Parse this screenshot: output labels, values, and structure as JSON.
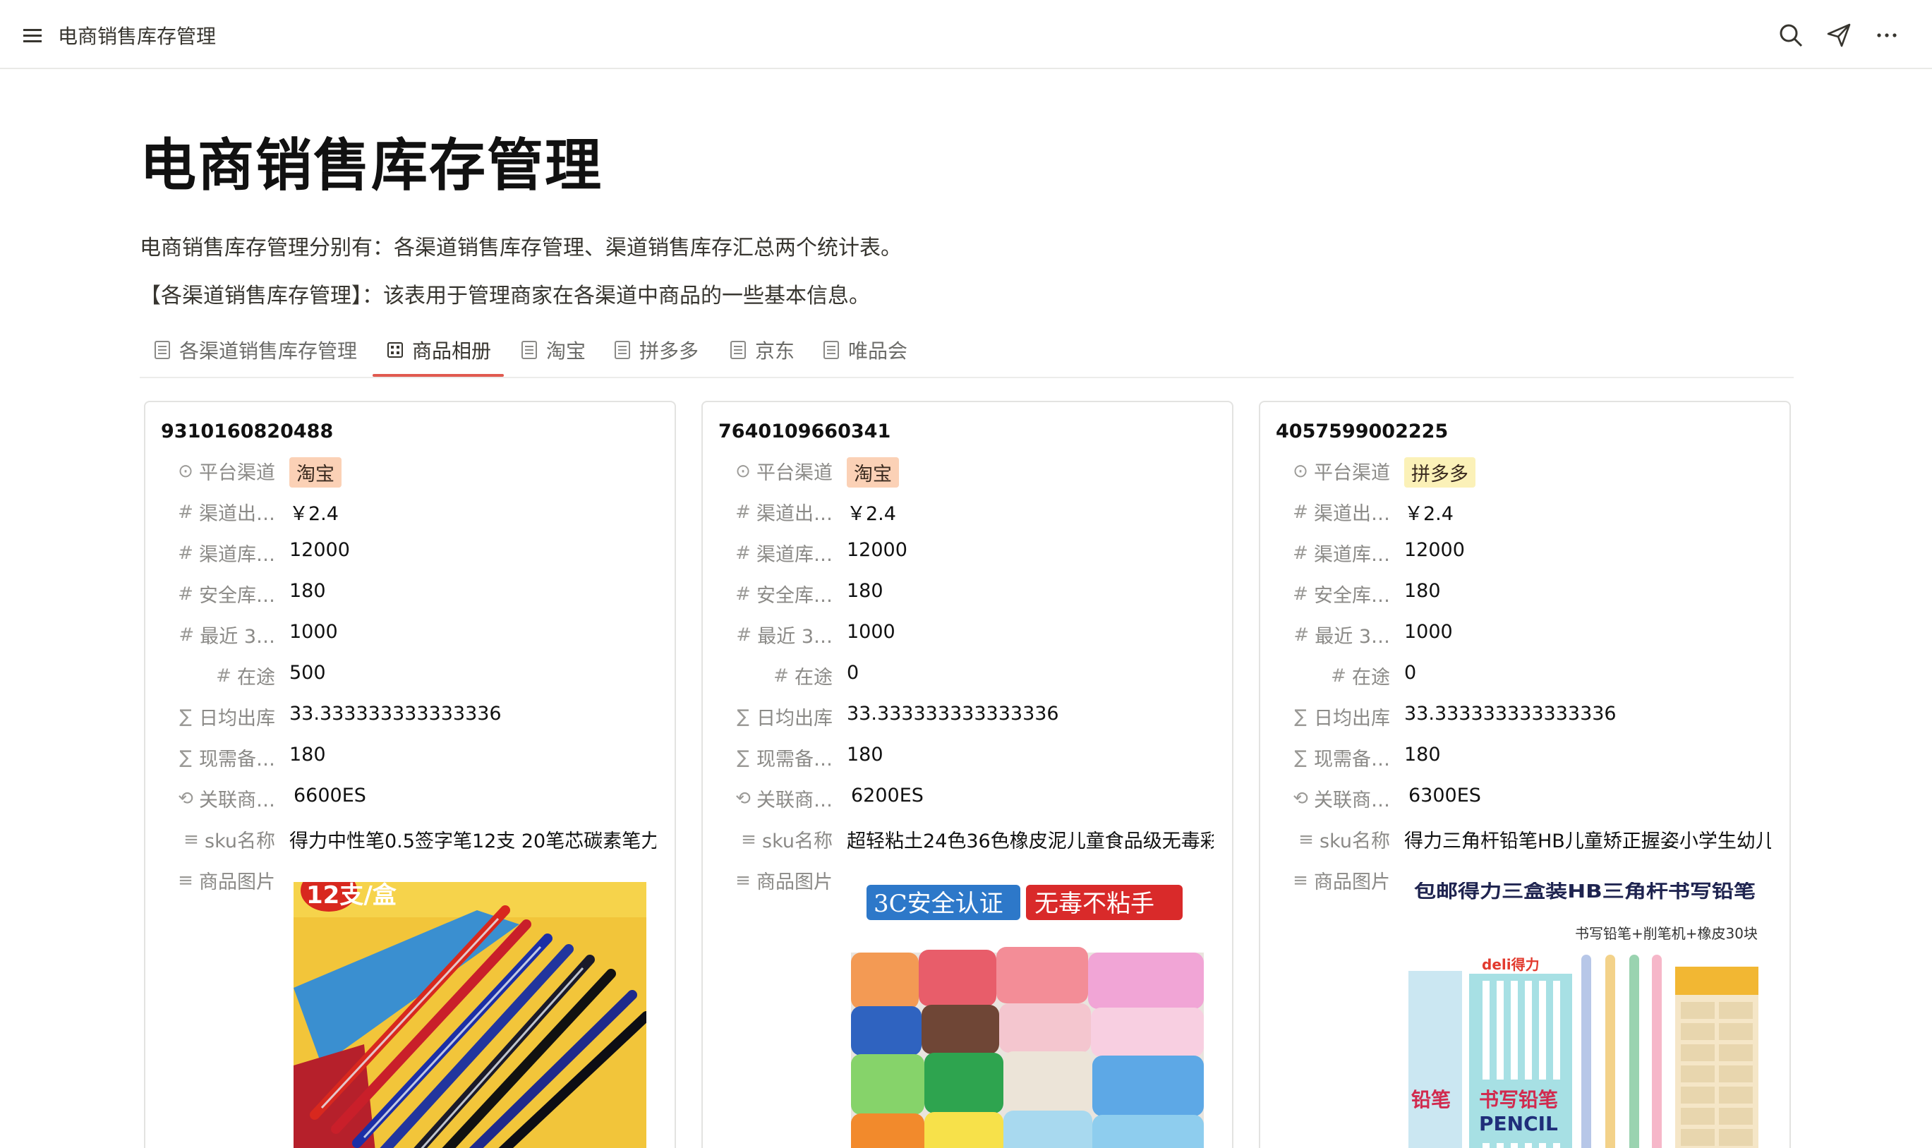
{
  "topbar": {
    "title": "电商销售库存管理"
  },
  "page": {
    "title": "电商销售库存管理",
    "desc1": "电商销售库存管理分别有：各渠道销售库存管理、渠道销售库存汇总两个统计表。",
    "desc2": "【各渠道销售库存管理】：该表用于管理商家在各渠道中商品的一些基本信息。"
  },
  "tabs": [
    {
      "label": "各渠道销售库存管理"
    },
    {
      "label": "商品相册"
    },
    {
      "label": "淘宝"
    },
    {
      "label": "拼多多"
    },
    {
      "label": "京东"
    },
    {
      "label": "唯品会"
    }
  ],
  "labels": {
    "channel": "平台渠道",
    "price": "渠道出…",
    "stock": "渠道库…",
    "safety": "安全库…",
    "recent": "最近 3…",
    "transit": "在途",
    "daily": "日均出库",
    "need": "现需备…",
    "related": "关联商…",
    "sku": "sku名称",
    "image": "商品图片"
  },
  "colors": {
    "accent": "#e05a4f",
    "tag_taobao": "#fbd1b6",
    "tag_pdd": "#fbf1b8"
  },
  "cards": [
    {
      "id": "9310160820488",
      "channel": "淘宝",
      "price": "￥2.4",
      "stock": "12000",
      "safety": "180",
      "recent": "1000",
      "transit": "500",
      "daily": "33.333333333333336",
      "need": "180",
      "related": "6600ES",
      "sku": "得力中性笔0.5签字笔12支 20笔芯碳素笔力",
      "img_text": "12支/盒"
    },
    {
      "id": "7640109660341",
      "channel": "淘宝",
      "price": "￥2.4",
      "stock": "12000",
      "safety": "180",
      "recent": "1000",
      "transit": "0",
      "daily": "33.333333333333336",
      "need": "180",
      "related": "6200ES",
      "sku": "超轻粘土24色36色橡皮泥儿童食品级无毒彩",
      "img_text1": "3C安全认证",
      "img_text2": "无毒不粘手"
    },
    {
      "id": "4057599002225",
      "channel": "拼多多",
      "price": "￥2.4",
      "stock": "12000",
      "safety": "180",
      "recent": "1000",
      "transit": "0",
      "daily": "33.333333333333336",
      "need": "180",
      "related": "6300ES",
      "sku": "得力三角杆铅笔HB儿童矫正握姿小学生幼儿",
      "img_text1": "包邮得力三盒装HB三角杆书写铅笔",
      "img_text2": "书写铅笔+削笔机+橡皮30块",
      "img_text3": "铅笔",
      "img_text4": "书写铅笔",
      "img_text5": "PENCIL",
      "img_text6": "deli得力"
    }
  ]
}
